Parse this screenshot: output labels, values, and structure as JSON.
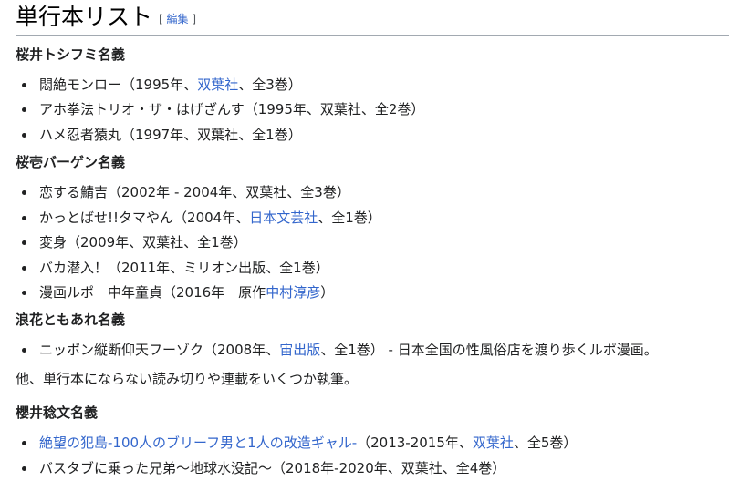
{
  "section": {
    "title": "単行本リスト",
    "edit_open": "[ ",
    "edit_label": "編集",
    "edit_close": " ]"
  },
  "groups": [
    {
      "heading": "桜井トシフミ名義",
      "items": [
        {
          "a": "悶絶モンロー（1995年、",
          "link": "双葉社",
          "b": "、全3巻）"
        },
        {
          "a": "アホ拳法トリオ・ザ・はげざんす（1995年、双葉社、全2巻）"
        },
        {
          "a": "ハメ忍者猿丸（1997年、双葉社、全1巻）"
        }
      ]
    },
    {
      "heading": "桜壱バーゲン名義",
      "items": [
        {
          "a": "恋する鯖吉（2002年 - 2004年、双葉社、全3巻）"
        },
        {
          "a": "かっとばせ!!タマやん（2004年、",
          "link": "日本文芸社",
          "b": "、全1巻）"
        },
        {
          "a": "変身（2009年、双葉社、全1巻）"
        },
        {
          "a": "バカ潜入！（2011年、ミリオン出版、全1巻）"
        },
        {
          "a": "漫画ルポ　中年童貞（2016年　原作",
          "link": "中村淳彦",
          "b": "）"
        }
      ]
    },
    {
      "heading": "浪花ともあれ名義",
      "items": [
        {
          "a": "ニッポン縦断仰天フーゾク（2008年、",
          "link": "宙出版",
          "b": "、全1巻） - 日本全国の性風俗店を渡り歩くルポ漫画。"
        }
      ]
    },
    {
      "heading": "櫻井稔文名義",
      "items": [
        {
          "link": "絶望の犯島-100人のブリーフ男と1人の改造ギャル-",
          "b": "（2013-2015年、",
          "link2": "双葉社",
          "c": "、全5巻）"
        },
        {
          "a": "バスタブに乗った兄弟〜地球水没記〜（2018年-2020年、双葉社、全4巻）"
        }
      ]
    }
  ],
  "paragraph": "他、単行本にならない読み切りや連載をいくつか執筆。"
}
